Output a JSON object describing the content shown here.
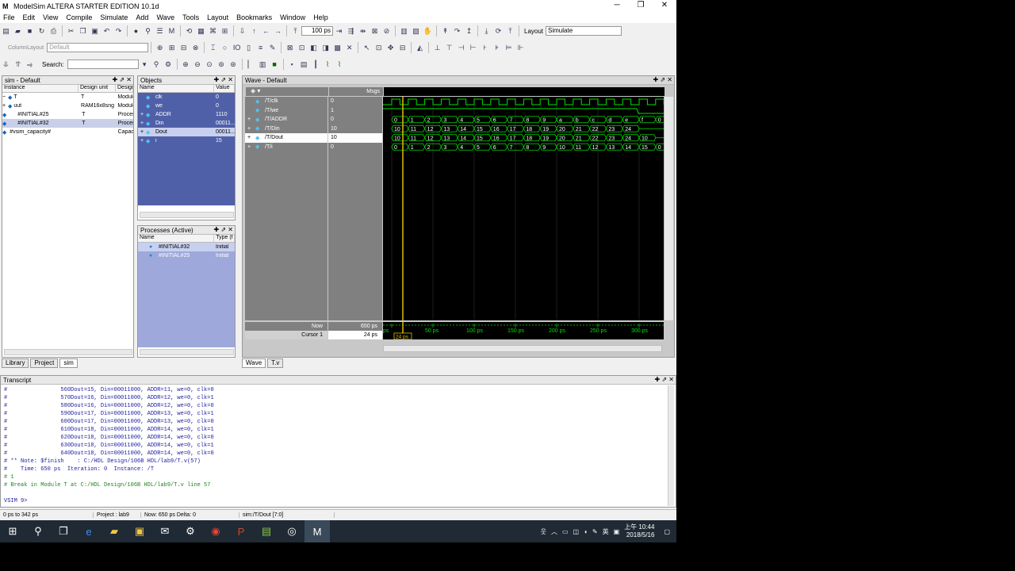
{
  "window": {
    "title": "ModelSim ALTERA STARTER EDITION 10.1d",
    "min": "─",
    "max": "❐",
    "close": "✕"
  },
  "menu": [
    "File",
    "Edit",
    "View",
    "Compile",
    "Simulate",
    "Add",
    "Wave",
    "Tools",
    "Layout",
    "Bookmarks",
    "Window",
    "Help"
  ],
  "toolbar": {
    "run_length": "100 ps",
    "layout_label": "Layout",
    "layout_value": "Simulate",
    "column_layout_label": "ColumnLayout",
    "column_layout_value": "Default",
    "search_label": "Search:"
  },
  "sim_panel": {
    "title": "sim - Default",
    "columns": [
      "Instance",
      "Design unit",
      "Design"
    ],
    "rows": [
      {
        "name": "T",
        "unit": "T",
        "type": "Module",
        "indent": 0,
        "exp": "−"
      },
      {
        "name": "uut",
        "unit": "RAM16x8sng",
        "type": "Module",
        "indent": 1,
        "exp": "+"
      },
      {
        "name": "#INITIAL#25",
        "unit": "T",
        "type": "Process",
        "indent": 1,
        "exp": ""
      },
      {
        "name": "#INITIAL#32",
        "unit": "T",
        "type": "Process",
        "indent": 1,
        "exp": ""
      },
      {
        "name": "#vsim_capacity#",
        "unit": "",
        "type": "Capacity",
        "indent": 0,
        "exp": ""
      }
    ],
    "tabs": [
      "Library",
      "Project",
      "sim"
    ]
  },
  "objects_panel": {
    "title": "Objects",
    "columns": [
      "Name",
      "Value"
    ],
    "rows": [
      {
        "name": "clk",
        "value": "0",
        "exp": ""
      },
      {
        "name": "we",
        "value": "0",
        "exp": ""
      },
      {
        "name": "ADDR",
        "value": "1110",
        "exp": "+"
      },
      {
        "name": "Din",
        "value": "00011...",
        "exp": "+"
      },
      {
        "name": "Dout",
        "value": "00011...",
        "exp": "+"
      },
      {
        "name": "i",
        "value": "15",
        "exp": "+"
      }
    ]
  },
  "processes_panel": {
    "title": "Processes (Active)",
    "columns": [
      "Name",
      "Type (f"
    ],
    "rows": [
      {
        "name": "#INITIAL#32",
        "type": "Initial"
      },
      {
        "name": "#INITIAL#25",
        "type": "Initial"
      }
    ]
  },
  "wave_panel": {
    "title": "Wave - Default",
    "msgs": "Msgs",
    "signals": [
      {
        "name": "/T/clk",
        "value": "0",
        "exp": ""
      },
      {
        "name": "/T/we",
        "value": "1",
        "exp": ""
      },
      {
        "name": "/T/ADDR",
        "value": "0",
        "exp": "+"
      },
      {
        "name": "/T/Din",
        "value": "10",
        "exp": "+"
      },
      {
        "name": "/T/Dout",
        "value": "10",
        "exp": "+"
      },
      {
        "name": "/T/i",
        "value": "0",
        "exp": "+"
      }
    ],
    "buses": [
      [
        "0",
        "1",
        "2",
        "3",
        "4",
        "5",
        "6",
        "7",
        "8",
        "9",
        "a",
        "b",
        "c",
        "d",
        "e",
        "f",
        "0"
      ],
      [
        "10",
        "11",
        "12",
        "13",
        "14",
        "15",
        "16",
        "17",
        "18",
        "19",
        "20",
        "21",
        "22",
        "23",
        "24"
      ],
      [
        "10",
        "11",
        "12",
        "13",
        "14",
        "15",
        "16",
        "17",
        "18",
        "19",
        "20",
        "21",
        "22",
        "23",
        "24",
        "10"
      ],
      [
        "0",
        "1",
        "2",
        "3",
        "4",
        "5",
        "6",
        "7",
        "8",
        "9",
        "10",
        "11",
        "12",
        "13",
        "14",
        "15",
        "0"
      ]
    ],
    "now_label": "Now",
    "now_value": "650 ps",
    "cursor_label": "Cursor 1",
    "cursor_value": "24 ps",
    "cursor_tag": "24 ps",
    "time_ticks": [
      "ps",
      "50 ps",
      "100 ps",
      "150 ps",
      "200 ps",
      "250 ps",
      "300 ps"
    ],
    "tabs": [
      "Wave",
      "T.v"
    ]
  },
  "transcript": {
    "title": "Transcript",
    "lines": [
      {
        "t": "#                560Dout=15, Din=00011000, ADDR=11, we=0, clk=0",
        "c": ""
      },
      {
        "t": "#                570Dout=16, Din=00011000, ADDR=12, we=0, clk=1",
        "c": ""
      },
      {
        "t": "#                580Dout=16, Din=00011000, ADDR=12, we=0, clk=0",
        "c": ""
      },
      {
        "t": "#                590Dout=17, Din=00011000, ADDR=13, we=0, clk=1",
        "c": ""
      },
      {
        "t": "#                600Dout=17, Din=00011000, ADDR=13, we=0, clk=0",
        "c": ""
      },
      {
        "t": "#                610Dout=18, Din=00011000, ADDR=14, we=0, clk=1",
        "c": ""
      },
      {
        "t": "#                620Dout=18, Din=00011000, ADDR=14, we=0, clk=0",
        "c": ""
      },
      {
        "t": "#                630Dout=18, Din=00011000, ADDR=14, we=0, clk=1",
        "c": ""
      },
      {
        "t": "#                640Dout=18, Din=00011000, ADDR=14, we=0, clk=0",
        "c": ""
      },
      {
        "t": "# ** Note: $finish    : C:/HDL Design/106B HDL/lab9/T.v(57)",
        "c": ""
      },
      {
        "t": "#    Time: 650 ps  Iteration: 0  Instance: /T",
        "c": ""
      },
      {
        "t": "# 1",
        "c": "green"
      },
      {
        "t": "# Break in Module T at C:/HDL Design/106B HDL/lab9/T.v line 57",
        "c": "green"
      },
      {
        "t": "",
        "c": ""
      },
      {
        "t": "VSIM 9>",
        "c": ""
      }
    ]
  },
  "status": {
    "range": "0 ps to 342 ps",
    "project": "Project : lab9",
    "now": "Now: 650 ps  Delta: 0",
    "path": "sim:/T/Dout [7:0]"
  },
  "taskbar": {
    "time": "上午 10:44",
    "date": "2018/5/16",
    "ime": "英"
  },
  "colors": {
    "highlight": "#9fa8da",
    "wave_green": "#00e000",
    "cursor": "#e0c000"
  }
}
